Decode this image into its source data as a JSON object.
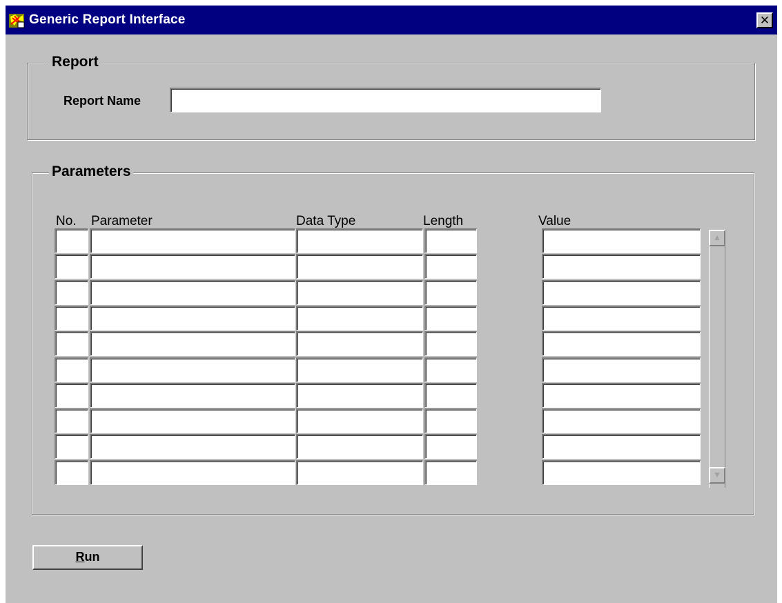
{
  "window": {
    "title": "Generic Report Interface",
    "close_glyph": "✕"
  },
  "report_group": {
    "title": "Report",
    "report_name_label": "Report Name",
    "report_name_value": ""
  },
  "parameters_group": {
    "title": "Parameters",
    "columns": {
      "no": "No.",
      "parameter": "Parameter",
      "data_type": "Data Type",
      "length": "Length",
      "value": "Value"
    },
    "rows": [
      {
        "no": "",
        "parameter": "",
        "data_type": "",
        "length": "",
        "value": ""
      },
      {
        "no": "",
        "parameter": "",
        "data_type": "",
        "length": "",
        "value": ""
      },
      {
        "no": "",
        "parameter": "",
        "data_type": "",
        "length": "",
        "value": ""
      },
      {
        "no": "",
        "parameter": "",
        "data_type": "",
        "length": "",
        "value": ""
      },
      {
        "no": "",
        "parameter": "",
        "data_type": "",
        "length": "",
        "value": ""
      },
      {
        "no": "",
        "parameter": "",
        "data_type": "",
        "length": "",
        "value": ""
      },
      {
        "no": "",
        "parameter": "",
        "data_type": "",
        "length": "",
        "value": ""
      },
      {
        "no": "",
        "parameter": "",
        "data_type": "",
        "length": "",
        "value": ""
      },
      {
        "no": "",
        "parameter": "",
        "data_type": "",
        "length": "",
        "value": ""
      },
      {
        "no": "",
        "parameter": "",
        "data_type": "",
        "length": "",
        "value": ""
      }
    ],
    "scroll_up_glyph": "▲",
    "scroll_down_glyph": "▼"
  },
  "run_button": {
    "mnemonic": "R",
    "label_rest": "un"
  },
  "colors": {
    "titlebar": "#000080",
    "face": "#c0c0c0"
  },
  "icons": {
    "app": "forms-app-icon",
    "close": "close-icon",
    "scroll_up": "scroll-up-arrow-icon",
    "scroll_down": "scroll-down-arrow-icon"
  }
}
